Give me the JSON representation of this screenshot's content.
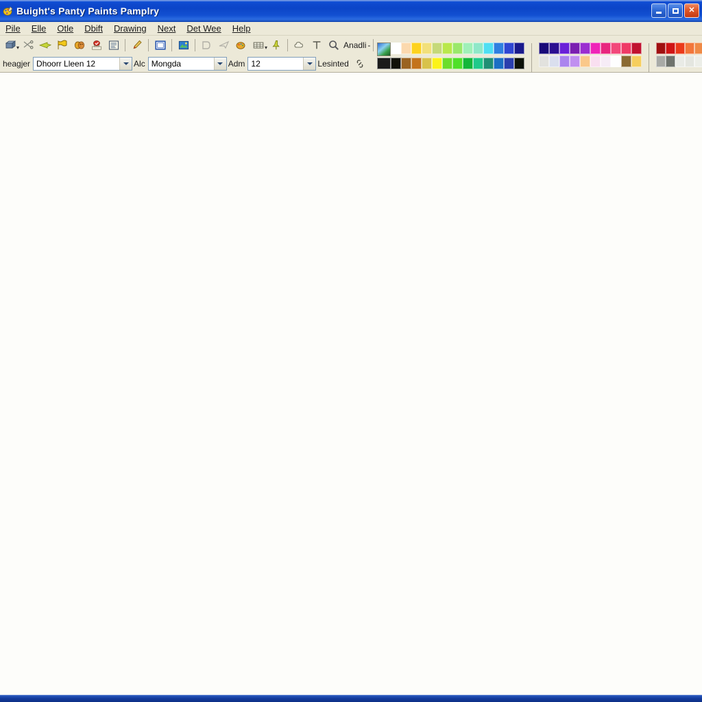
{
  "window": {
    "title": "Buight's Panty Paints Pamplry",
    "app_icon": "paint-palette-icon",
    "controls": {
      "minimize": "minimize-button",
      "maximize": "maximize-button",
      "close": "close-button",
      "close_glyph": "✕"
    }
  },
  "menu": {
    "items": [
      {
        "label": "Pile",
        "mnemonic": "P"
      },
      {
        "label": "Elle",
        "mnemonic": "E"
      },
      {
        "label": "Otle",
        "mnemonic": "O"
      },
      {
        "label": "Dbift",
        "mnemonic": "D"
      },
      {
        "label": "Drawing",
        "mnemonic": "D"
      },
      {
        "label": "Next",
        "mnemonic": "N"
      },
      {
        "label": "Det Wee",
        "mnemonic": "D"
      },
      {
        "label": "Help",
        "mnemonic": "H"
      }
    ]
  },
  "toolbar": {
    "buttons": [
      {
        "name": "new-document-icon",
        "dim": false,
        "caret": true
      },
      {
        "name": "cut-scissors-icon",
        "dim": false,
        "caret": false
      },
      {
        "name": "send-arrow-icon",
        "dim": false,
        "caret": false
      },
      {
        "name": "flag-marker-icon",
        "dim": false,
        "caret": false
      },
      {
        "name": "masks-theater-icon",
        "dim": false,
        "caret": false
      },
      {
        "name": "stamp-approve-icon",
        "dim": false,
        "caret": false
      },
      {
        "name": "clipboard-list-icon",
        "dim": false,
        "caret": false
      },
      {
        "name": "brush-pen-icon",
        "dim": false,
        "caret": false
      },
      {
        "name": "frame-border-icon",
        "dim": false,
        "caret": false
      },
      {
        "name": "picture-insert-icon",
        "dim": false,
        "caret": false
      },
      {
        "name": "shape-polygon-icon",
        "dim": true,
        "caret": false
      },
      {
        "name": "airplane-send-icon",
        "dim": true,
        "caret": false
      },
      {
        "name": "palette-mix-icon",
        "dim": false,
        "caret": false
      },
      {
        "name": "table-grid-icon",
        "dim": false,
        "caret": true
      },
      {
        "name": "pushpin-icon",
        "dim": false,
        "caret": false
      },
      {
        "name": "cloud-shape-icon",
        "dim": false,
        "caret": false
      },
      {
        "name": "text-tool-icon",
        "dim": false,
        "caret": false
      }
    ],
    "zoom": {
      "icon": "magnifier-icon",
      "label": "Anadli",
      "caret": "-"
    },
    "image_button": "image-thumbnail-icon"
  },
  "format_bar": {
    "font_label": "heagjer",
    "font_value": "Dhoorr Lleen 12",
    "style_label": "Alc",
    "style_value": "Mongda",
    "size_label": "Adm",
    "size_value": "12",
    "linked_label": "Lesinted",
    "link_icon": "chain-link-icon",
    "ink_swatch": "#0a0a0a"
  },
  "palettes": {
    "group_main": {
      "tile_icon": "palette-preview-tile",
      "row_top": [
        "#ffffff",
        "#fbd9ae",
        "#fdd21f",
        "#f2e07a",
        "#c5d979",
        "#b9e84b",
        "#9ae86a",
        "#9ff0b8",
        "#8fe8c8",
        "#4fdff2",
        "#2f7fe0",
        "#2f46d2",
        "#1a1a8c"
      ],
      "row_bottom_tile": "#1b1b1b",
      "row_bottom": [
        "#101008",
        "#9a6320",
        "#c4731c",
        "#d8c24a",
        "#fbf318",
        "#6ddd2a",
        "#4fe028",
        "#13b63a",
        "#1fc98a",
        "#1f8f74",
        "#1b6fc4",
        "#2a3fae",
        "#0d1208"
      ]
    },
    "group_purple": {
      "row_top": [
        "#190a78",
        "#2b0f90",
        "#6a20d8",
        "#7a1fb0",
        "#9a2ed0",
        "#ef24b8",
        "#e8267e",
        "#f2487a",
        "#ef3a66",
        "#c01230"
      ],
      "row_bottom": [
        "#e2e2de",
        "#dadfee",
        "#ab84ee",
        "#c08ff0",
        "#fac88a",
        "#f9dff0",
        "#f6ecf6",
        "#fefefe",
        "#8a6a32",
        "#f6ce5e"
      ]
    },
    "group_warm": {
      "row_top": [
        "#a01010",
        "#cf1414",
        "#eb3a1a",
        "#f2763a",
        "#ef8a46"
      ],
      "row_bottom": [
        "#a8aaa6",
        "#6e736d",
        "#e9ebe6",
        "#e4e6e0",
        "#eceee8"
      ]
    },
    "photo_thumbnail": "portrait-photo-thumbnail"
  },
  "canvas": {
    "name": "drawing-canvas",
    "background": "#fdfdfa"
  },
  "status": {
    "name": "status-bar"
  }
}
